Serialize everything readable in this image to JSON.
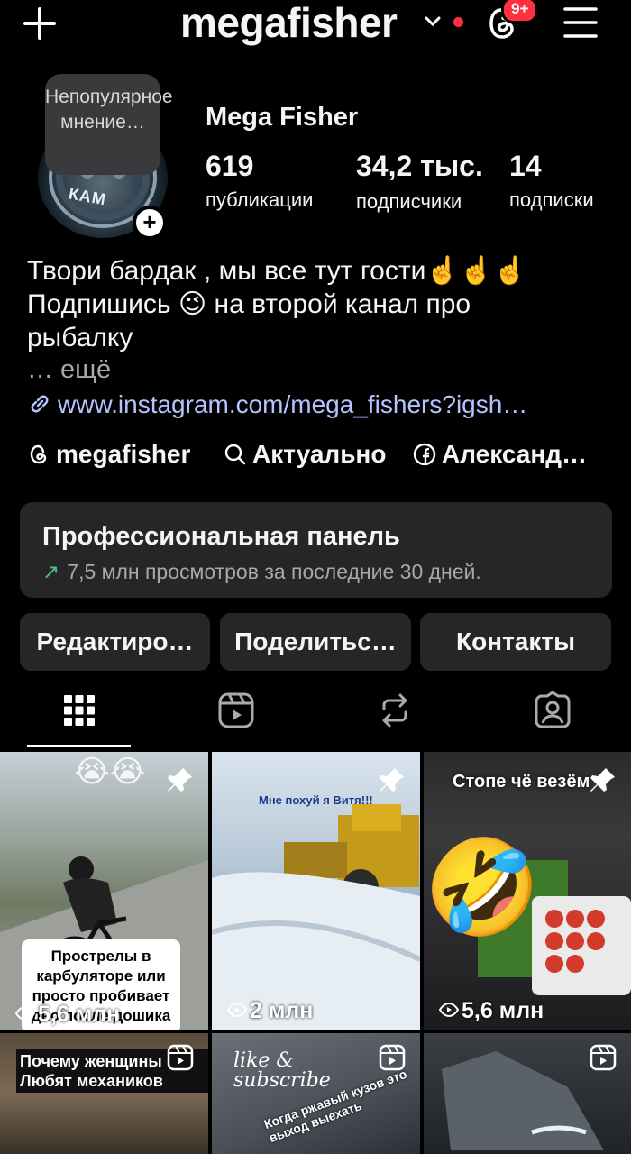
{
  "header": {
    "username": "megafisher",
    "notif_badge": "9+"
  },
  "profile": {
    "tooltip": "Непопулярное мнение…",
    "avatar_text": "КАМ",
    "full_name": "Mega Fisher",
    "stats": [
      {
        "value": "619",
        "label": "публикации"
      },
      {
        "value": "34,2 тыс.",
        "label": "подписчики"
      },
      {
        "value": "14",
        "label": "подписки"
      }
    ],
    "bio_lines": [
      "Твори бардак , мы все тут гости☝️☝️☝️",
      "Подпишись 😉 на второй канал про",
      "рыбалку"
    ],
    "more": "… ещё",
    "link": "www.instagram.com/mega_fishers?igsh…",
    "chips": [
      "megafisher",
      "Актуально",
      "Александ…"
    ]
  },
  "pro_panel": {
    "title": "Профессиональная панель",
    "subtitle": "7,5 млн просмотров за последние 30 дней."
  },
  "buttons": {
    "edit": "Редактиро…",
    "share": "Поделитьс…",
    "contacts": "Контакты"
  },
  "grid": [
    {
      "emoji": "😭😭",
      "caption": "Прострелы в карбуляторе или просто пробивает дно после дошика",
      "views": "5,6 млн"
    },
    {
      "overlay": "Мне похуй я Витя!!!",
      "views": "2 млн"
    },
    {
      "overlay": "Стопе чё везём",
      "emoji": "🤣",
      "views": "5,6 млн"
    },
    {
      "overlay": "Почему женщины Любят механиков"
    },
    {
      "overlay": "like & subscribe",
      "overlay2": "Когда ржавый кузов это выход выехать"
    },
    {}
  ],
  "colors": {
    "accent_link": "#b5c3ff",
    "badge": "#ff3040",
    "panel_bg": "#262628",
    "trend_green": "#46c37b"
  }
}
